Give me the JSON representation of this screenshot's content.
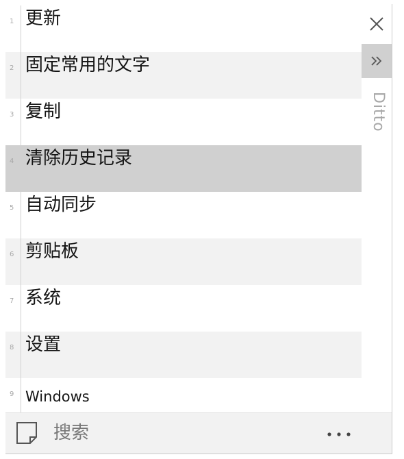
{
  "colors": {
    "row_alt": "#f2f2f2",
    "row_selected": "#d0d0d0",
    "row_plain": "#ffffff",
    "side_text": "#a8a8a8"
  },
  "clips": [
    {
      "index": "1",
      "text": "更新",
      "state": "plain"
    },
    {
      "index": "2",
      "text": "固定常用的文字",
      "state": "alt"
    },
    {
      "index": "3",
      "text": "复制",
      "state": "plain"
    },
    {
      "index": "4",
      "text": "清除历史记录",
      "state": "selected"
    },
    {
      "index": "5",
      "text": "自动同步",
      "state": "plain"
    },
    {
      "index": "6",
      "text": "剪贴板",
      "state": "alt"
    },
    {
      "index": "7",
      "text": "系统",
      "state": "plain"
    },
    {
      "index": "8",
      "text": "设置",
      "state": "alt"
    },
    {
      "index": "9",
      "text": "Windows",
      "state": "plain"
    }
  ],
  "sidebar": {
    "title": "Ditto",
    "close_icon": "close-icon",
    "expand_icon": "double-chevron-right-icon"
  },
  "footer": {
    "search_placeholder": "搜索",
    "note_icon": "note-icon",
    "more_icon": "more-horizontal-icon"
  }
}
